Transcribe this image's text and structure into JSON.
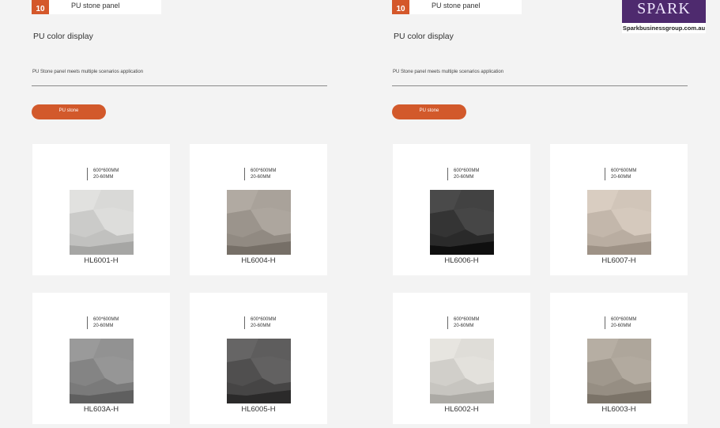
{
  "left_panel": {
    "badge_number": "10",
    "header_title": "PU stone panel",
    "section_title": "PU color display",
    "subtitle": "PU Stone panel meets multiple scenarios application",
    "pill_label": "PU stone",
    "cards": [
      {
        "size": "600*600MM",
        "thickness": "20-60MM",
        "code": "HL6001-H",
        "swatch_icon": "light-grey-stone-swatch",
        "color": "#d3d3d1"
      },
      {
        "size": "600*600MM",
        "thickness": "20-60MM",
        "code": "HL6004-H",
        "swatch_icon": "beige-grey-stone-swatch",
        "color": "#a39c94"
      },
      {
        "size": "600*600MM",
        "thickness": "20-60MM",
        "code": "HL603A-H",
        "swatch_icon": "medium-grey-stone-swatch",
        "color": "#8c8c8c"
      },
      {
        "size": "600*600MM",
        "thickness": "20-60MM",
        "code": "HL6005-H",
        "swatch_icon": "dark-grey-stone-swatch",
        "color": "#585757"
      }
    ]
  },
  "right_panel": {
    "badge_number": "10",
    "header_title": "PU stone panel",
    "section_title": "PU color display",
    "subtitle": "PU Stone panel meets multiple scenarios application",
    "pill_label": "PU stone",
    "cards": [
      {
        "size": "600*600MM",
        "thickness": "20-60MM",
        "code": "HL6006-H",
        "swatch_icon": "black-stone-swatch",
        "color": "#3c3c3c"
      },
      {
        "size": "600*600MM",
        "thickness": "20-60MM",
        "code": "HL6007-H",
        "swatch_icon": "sand-stone-swatch",
        "color": "#cbbfb3"
      },
      {
        "size": "600*600MM",
        "thickness": "20-60MM",
        "code": "HL6002-H",
        "swatch_icon": "off-white-stone-swatch",
        "color": "#d9d7d2"
      },
      {
        "size": "600*600MM",
        "thickness": "20-60MM",
        "code": "HL6003-H",
        "swatch_icon": "taupe-stone-swatch",
        "color": "#a8a095"
      }
    ]
  },
  "logo": {
    "word": "SPARK",
    "url": "Sparkbusinessgroup.com.au"
  },
  "colors": {
    "accent": "#d2592b",
    "background": "#f3f3f3",
    "card": "#ffffff"
  }
}
